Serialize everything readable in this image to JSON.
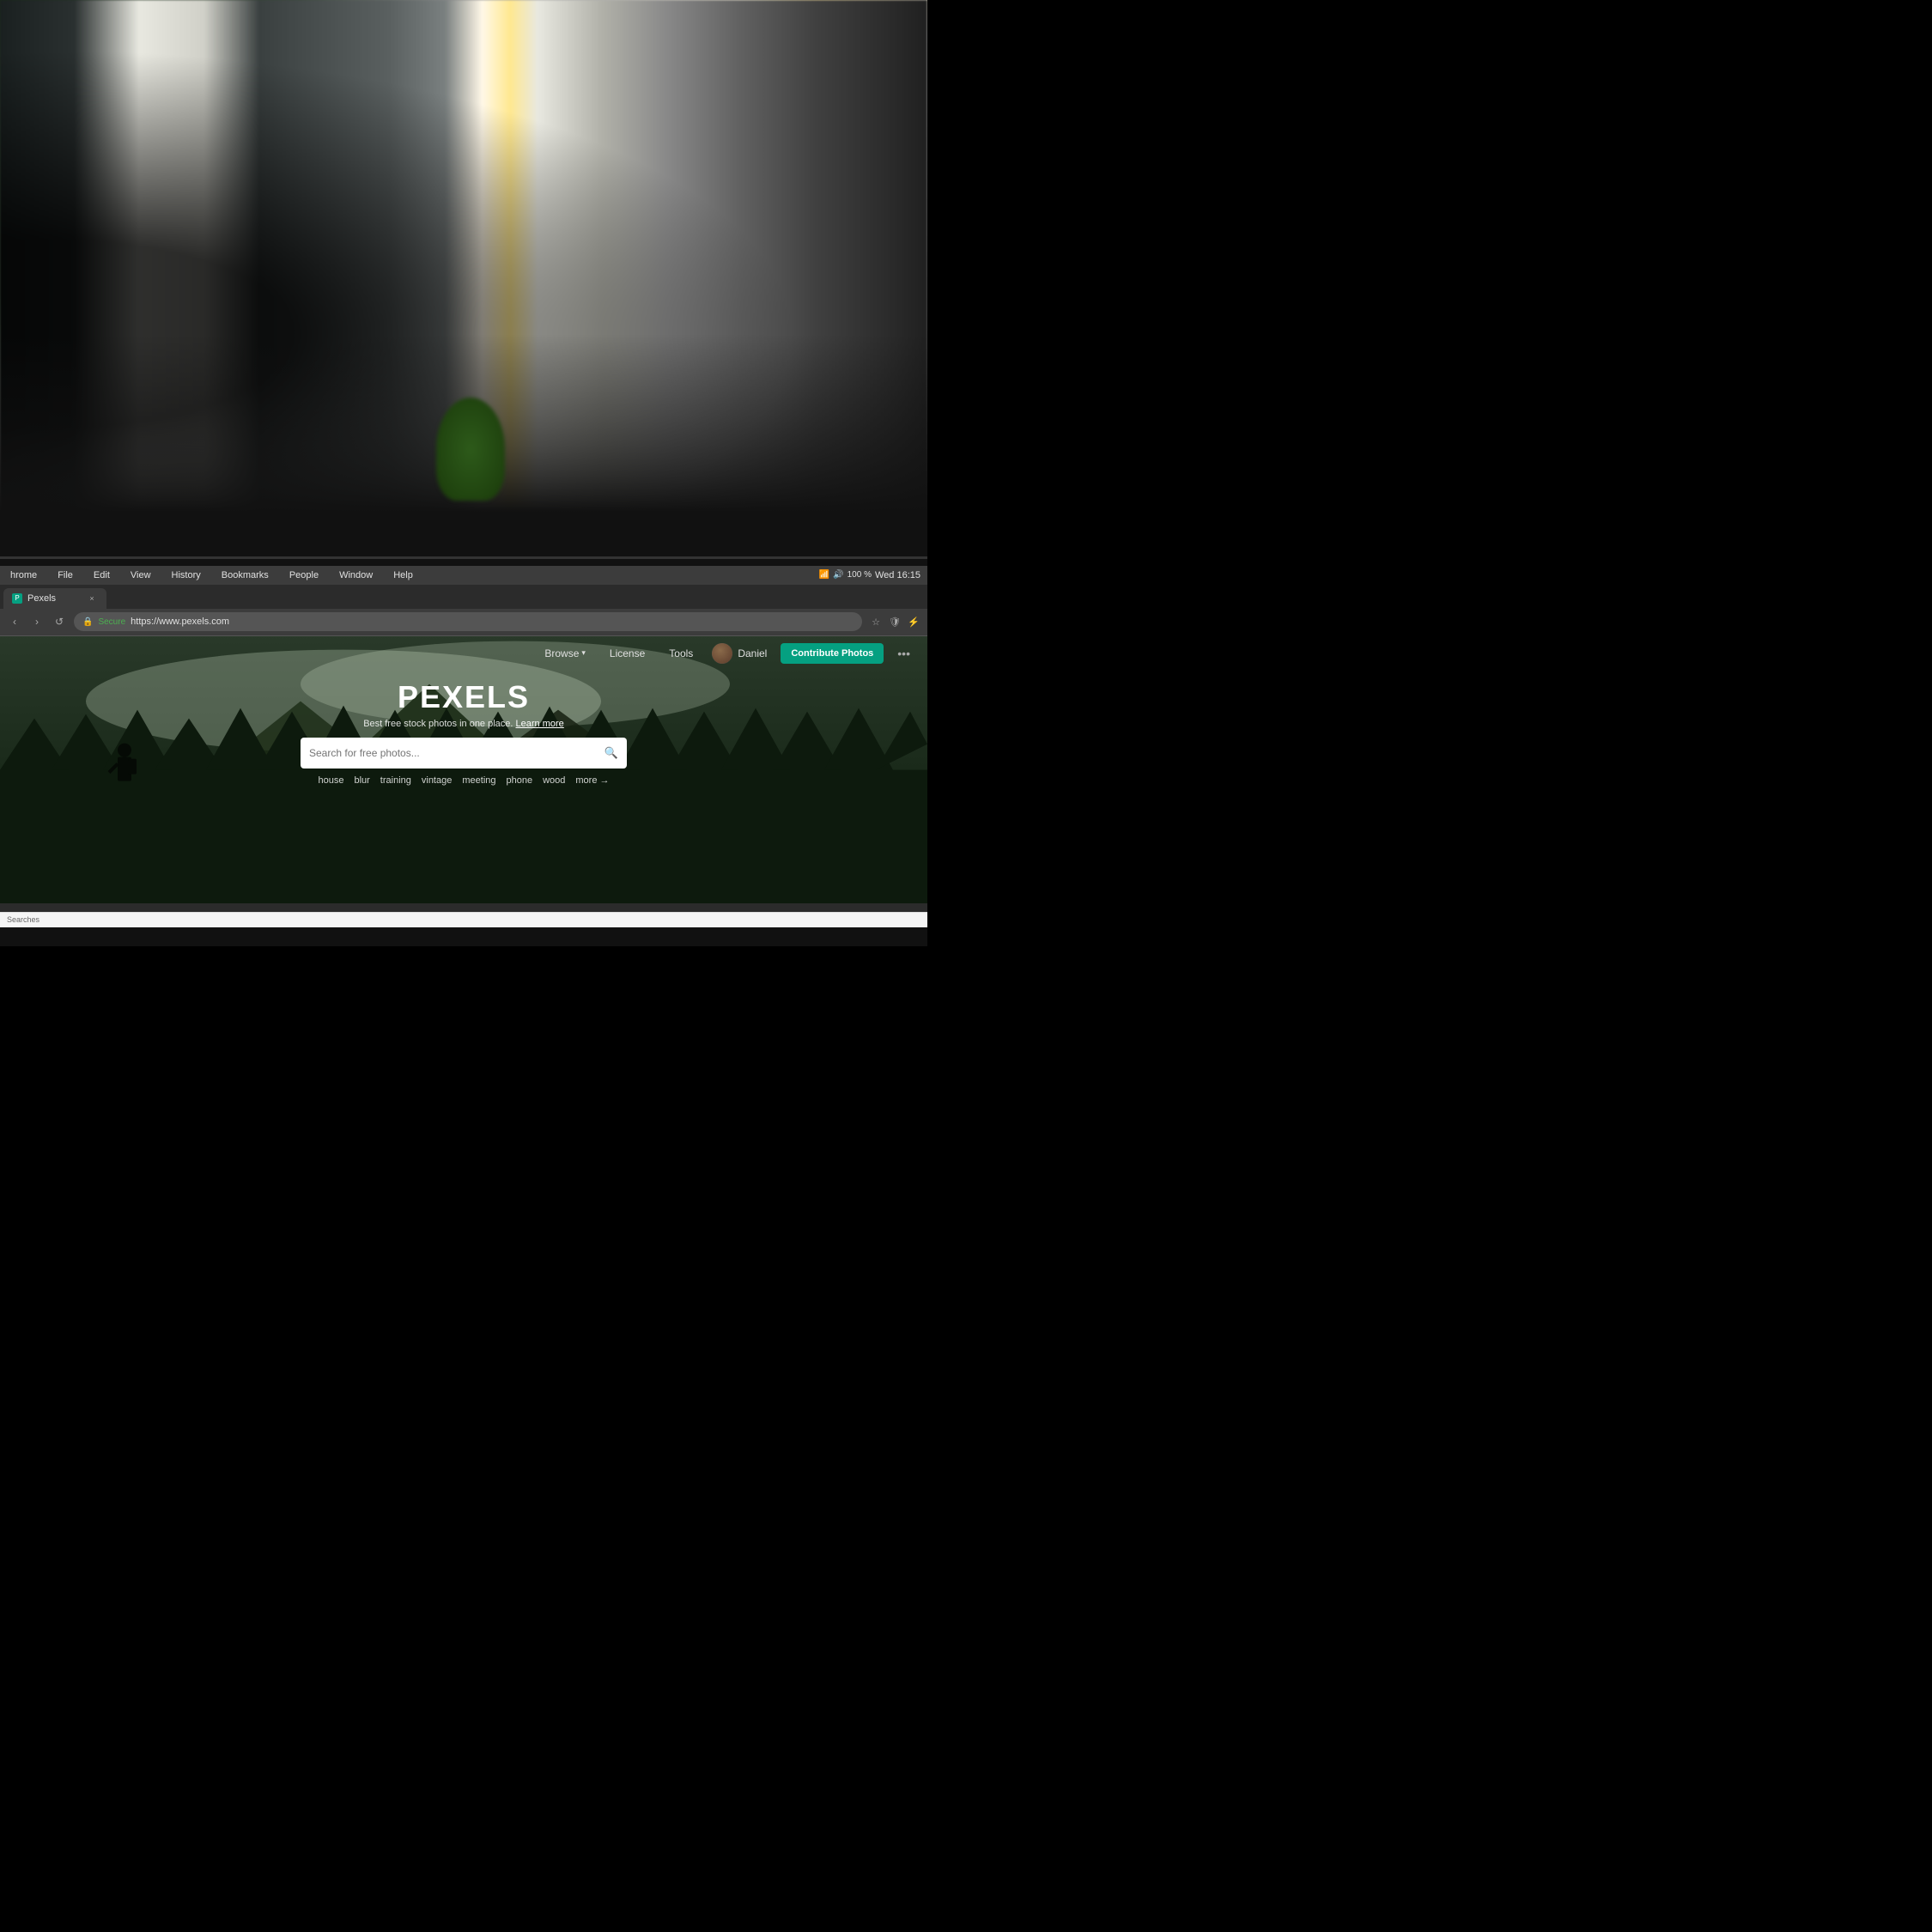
{
  "background": {
    "description": "Office workspace background photo with columns, plants, and windows"
  },
  "system": {
    "time": "Wed 16:15",
    "battery": "100 %",
    "battery_icon": "🔋",
    "wifi_icon": "📶",
    "volume_icon": "🔊"
  },
  "browser": {
    "menu_items": [
      "hrome",
      "File",
      "Edit",
      "View",
      "History",
      "Bookmarks",
      "People",
      "Window",
      "Help"
    ],
    "tab_title": "Pexels",
    "url_protocol": "Secure",
    "url": "https://www.pexels.com",
    "tab_close": "×",
    "nav_back": "‹",
    "nav_forward": "›",
    "nav_refresh": "↺"
  },
  "website": {
    "logo": "PEXELS",
    "tagline": "Best free stock photos in one place.",
    "tagline_link": "Learn more",
    "search_placeholder": "Search for free photos...",
    "nav": {
      "browse": "Browse",
      "browse_arrow": "▾",
      "license": "License",
      "tools": "Tools",
      "user_name": "Daniel",
      "contribute_btn": "Contribute Photos",
      "more_dots": "•••"
    },
    "search_tags": [
      "house",
      "blur",
      "training",
      "vintage",
      "meeting",
      "phone",
      "wood"
    ],
    "more_label": "more →"
  },
  "status_bar": {
    "text": "Searches"
  }
}
